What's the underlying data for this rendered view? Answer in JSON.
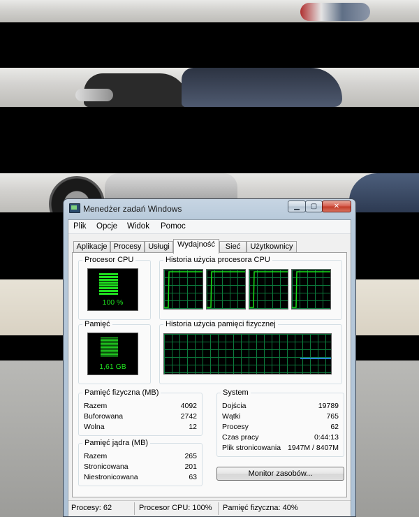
{
  "window": {
    "title": "Menedżer zadań Windows",
    "min_label": "▁",
    "max_label": "▢",
    "close_label": "✕"
  },
  "menu": [
    "Plik",
    "Opcje",
    "Widok",
    "Pomoc"
  ],
  "tabs": [
    "Aplikacje",
    "Procesy",
    "Usługi",
    "Wydajność",
    "Sieć",
    "Użytkownicy"
  ],
  "active_tab": "Wydajność",
  "cpu": {
    "label": "Procesor CPU",
    "value": "100 %",
    "history_label": "Historia użycia procesora CPU"
  },
  "memory": {
    "label": "Pamięć",
    "value": "1,61 GB",
    "history_label": "Historia użycia pamięci fizycznej"
  },
  "physical_memory": {
    "title": "Pamięć fizyczna (MB)",
    "rows": [
      {
        "k": "Razem",
        "v": "4092"
      },
      {
        "k": "Buforowana",
        "v": "2742"
      },
      {
        "k": "Wolna",
        "v": "12"
      }
    ]
  },
  "kernel_memory": {
    "title": "Pamięć jądra (MB)",
    "rows": [
      {
        "k": "Razem",
        "v": "265"
      },
      {
        "k": "Stronicowana",
        "v": "201"
      },
      {
        "k": "Niestronicowana",
        "v": "63"
      }
    ]
  },
  "system": {
    "title": "System",
    "rows": [
      {
        "k": "Dojścia",
        "v": "19789"
      },
      {
        "k": "Wątki",
        "v": "765"
      },
      {
        "k": "Procesy",
        "v": "62"
      },
      {
        "k": "Czas pracy",
        "v": "0:44:13"
      },
      {
        "k": "Plik stronicowania",
        "v": "1947M / 8407M"
      }
    ]
  },
  "monitor_button": "Monitor zasobów...",
  "status": {
    "processes": "Procesy: 62",
    "cpu": "Procesor CPU: 100%",
    "memory": "Pamięć fizyczna: 40%"
  },
  "colors": {
    "graph_line": "#19e019",
    "graph_grid": "#0c7a3c",
    "memory_line": "#2a7fd4"
  }
}
